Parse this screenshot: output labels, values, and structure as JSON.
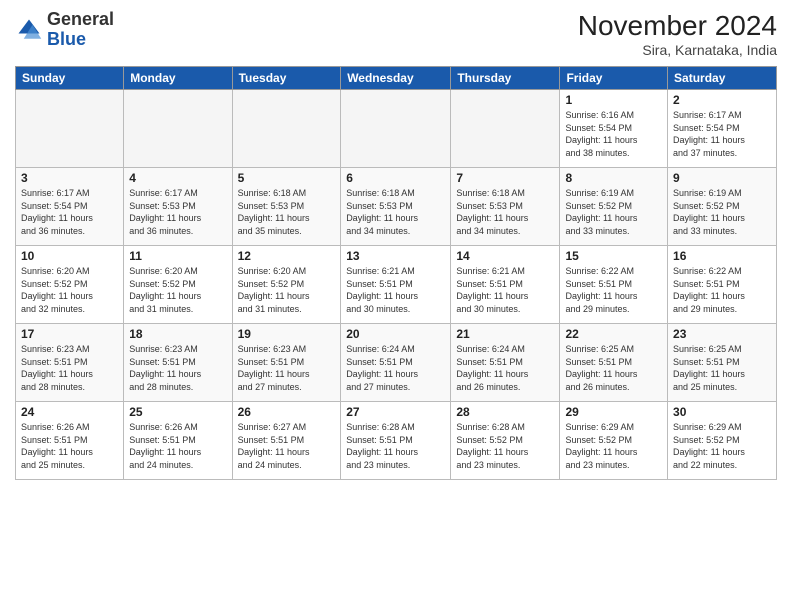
{
  "logo": {
    "general": "General",
    "blue": "Blue"
  },
  "header": {
    "title": "November 2024",
    "location": "Sira, Karnataka, India"
  },
  "days_of_week": [
    "Sunday",
    "Monday",
    "Tuesday",
    "Wednesday",
    "Thursday",
    "Friday",
    "Saturday"
  ],
  "weeks": [
    [
      {
        "day": "",
        "info": ""
      },
      {
        "day": "",
        "info": ""
      },
      {
        "day": "",
        "info": ""
      },
      {
        "day": "",
        "info": ""
      },
      {
        "day": "",
        "info": ""
      },
      {
        "day": "1",
        "info": "Sunrise: 6:16 AM\nSunset: 5:54 PM\nDaylight: 11 hours\nand 38 minutes."
      },
      {
        "day": "2",
        "info": "Sunrise: 6:17 AM\nSunset: 5:54 PM\nDaylight: 11 hours\nand 37 minutes."
      }
    ],
    [
      {
        "day": "3",
        "info": "Sunrise: 6:17 AM\nSunset: 5:54 PM\nDaylight: 11 hours\nand 36 minutes."
      },
      {
        "day": "4",
        "info": "Sunrise: 6:17 AM\nSunset: 5:53 PM\nDaylight: 11 hours\nand 36 minutes."
      },
      {
        "day": "5",
        "info": "Sunrise: 6:18 AM\nSunset: 5:53 PM\nDaylight: 11 hours\nand 35 minutes."
      },
      {
        "day": "6",
        "info": "Sunrise: 6:18 AM\nSunset: 5:53 PM\nDaylight: 11 hours\nand 34 minutes."
      },
      {
        "day": "7",
        "info": "Sunrise: 6:18 AM\nSunset: 5:53 PM\nDaylight: 11 hours\nand 34 minutes."
      },
      {
        "day": "8",
        "info": "Sunrise: 6:19 AM\nSunset: 5:52 PM\nDaylight: 11 hours\nand 33 minutes."
      },
      {
        "day": "9",
        "info": "Sunrise: 6:19 AM\nSunset: 5:52 PM\nDaylight: 11 hours\nand 33 minutes."
      }
    ],
    [
      {
        "day": "10",
        "info": "Sunrise: 6:20 AM\nSunset: 5:52 PM\nDaylight: 11 hours\nand 32 minutes."
      },
      {
        "day": "11",
        "info": "Sunrise: 6:20 AM\nSunset: 5:52 PM\nDaylight: 11 hours\nand 31 minutes."
      },
      {
        "day": "12",
        "info": "Sunrise: 6:20 AM\nSunset: 5:52 PM\nDaylight: 11 hours\nand 31 minutes."
      },
      {
        "day": "13",
        "info": "Sunrise: 6:21 AM\nSunset: 5:51 PM\nDaylight: 11 hours\nand 30 minutes."
      },
      {
        "day": "14",
        "info": "Sunrise: 6:21 AM\nSunset: 5:51 PM\nDaylight: 11 hours\nand 30 minutes."
      },
      {
        "day": "15",
        "info": "Sunrise: 6:22 AM\nSunset: 5:51 PM\nDaylight: 11 hours\nand 29 minutes."
      },
      {
        "day": "16",
        "info": "Sunrise: 6:22 AM\nSunset: 5:51 PM\nDaylight: 11 hours\nand 29 minutes."
      }
    ],
    [
      {
        "day": "17",
        "info": "Sunrise: 6:23 AM\nSunset: 5:51 PM\nDaylight: 11 hours\nand 28 minutes."
      },
      {
        "day": "18",
        "info": "Sunrise: 6:23 AM\nSunset: 5:51 PM\nDaylight: 11 hours\nand 28 minutes."
      },
      {
        "day": "19",
        "info": "Sunrise: 6:23 AM\nSunset: 5:51 PM\nDaylight: 11 hours\nand 27 minutes."
      },
      {
        "day": "20",
        "info": "Sunrise: 6:24 AM\nSunset: 5:51 PM\nDaylight: 11 hours\nand 27 minutes."
      },
      {
        "day": "21",
        "info": "Sunrise: 6:24 AM\nSunset: 5:51 PM\nDaylight: 11 hours\nand 26 minutes."
      },
      {
        "day": "22",
        "info": "Sunrise: 6:25 AM\nSunset: 5:51 PM\nDaylight: 11 hours\nand 26 minutes."
      },
      {
        "day": "23",
        "info": "Sunrise: 6:25 AM\nSunset: 5:51 PM\nDaylight: 11 hours\nand 25 minutes."
      }
    ],
    [
      {
        "day": "24",
        "info": "Sunrise: 6:26 AM\nSunset: 5:51 PM\nDaylight: 11 hours\nand 25 minutes."
      },
      {
        "day": "25",
        "info": "Sunrise: 6:26 AM\nSunset: 5:51 PM\nDaylight: 11 hours\nand 24 minutes."
      },
      {
        "day": "26",
        "info": "Sunrise: 6:27 AM\nSunset: 5:51 PM\nDaylight: 11 hours\nand 24 minutes."
      },
      {
        "day": "27",
        "info": "Sunrise: 6:28 AM\nSunset: 5:51 PM\nDaylight: 11 hours\nand 23 minutes."
      },
      {
        "day": "28",
        "info": "Sunrise: 6:28 AM\nSunset: 5:52 PM\nDaylight: 11 hours\nand 23 minutes."
      },
      {
        "day": "29",
        "info": "Sunrise: 6:29 AM\nSunset: 5:52 PM\nDaylight: 11 hours\nand 23 minutes."
      },
      {
        "day": "30",
        "info": "Sunrise: 6:29 AM\nSunset: 5:52 PM\nDaylight: 11 hours\nand 22 minutes."
      }
    ]
  ]
}
